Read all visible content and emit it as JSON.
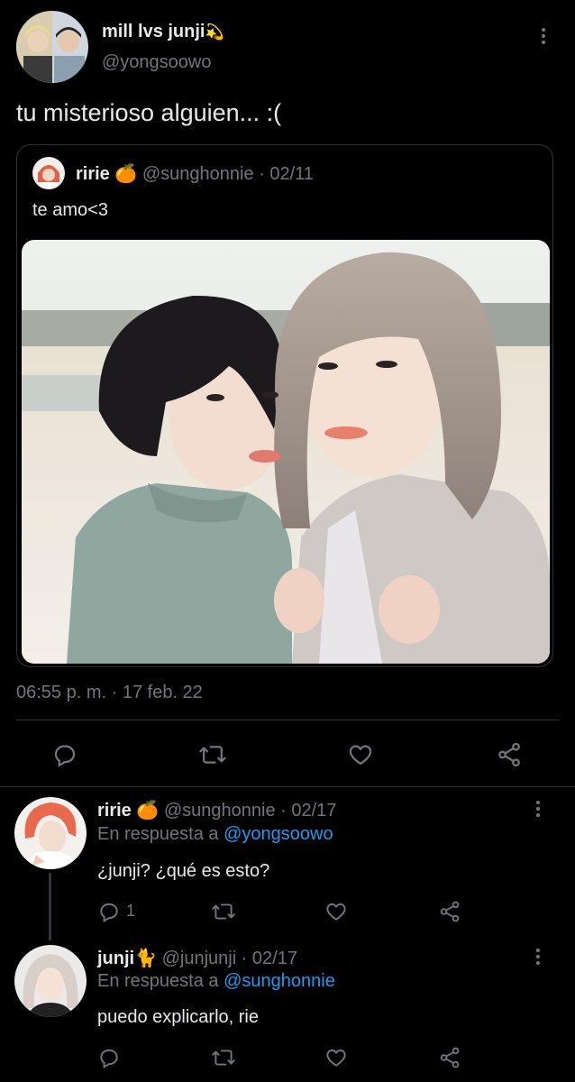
{
  "main_tweet": {
    "display_name": "mill lvs junji",
    "name_emoji": "💫",
    "handle": "@yongsoowo",
    "text": "tu misterioso alguien... :(",
    "timestamp": "06:55 p. m. · 17 feb. 22",
    "quoted": {
      "display_name": "ririe",
      "name_emoji": "🍊",
      "handle": "@sunghonnie",
      "date": "· 02/11",
      "text": "te amo<3"
    }
  },
  "replies": [
    {
      "display_name": "ririe",
      "name_emoji": "🍊",
      "handle": "@sunghonnie",
      "date": "· 02/17",
      "reply_prefix": "En respuesta a",
      "reply_to": "@yongsoowo",
      "text": "¿junji? ¿qué es esto?",
      "reply_count": "1"
    },
    {
      "display_name": "junji",
      "name_emoji": "🐈",
      "handle": "@junjunji",
      "date": "· 02/17",
      "reply_prefix": "En respuesta a",
      "reply_to": "@sunghonnie",
      "text": "puedo explicarlo, rie",
      "reply_count": ""
    }
  ],
  "icons": {
    "reply": "comment-icon",
    "retweet": "retweet-icon",
    "like": "heart-icon",
    "share": "share-icon",
    "more": "more-vertical-icon"
  },
  "colors": {
    "background": "#000000",
    "text": "#e7e9ea",
    "muted": "#71767b",
    "link": "#1d9bf0",
    "divider": "#2f3336"
  }
}
